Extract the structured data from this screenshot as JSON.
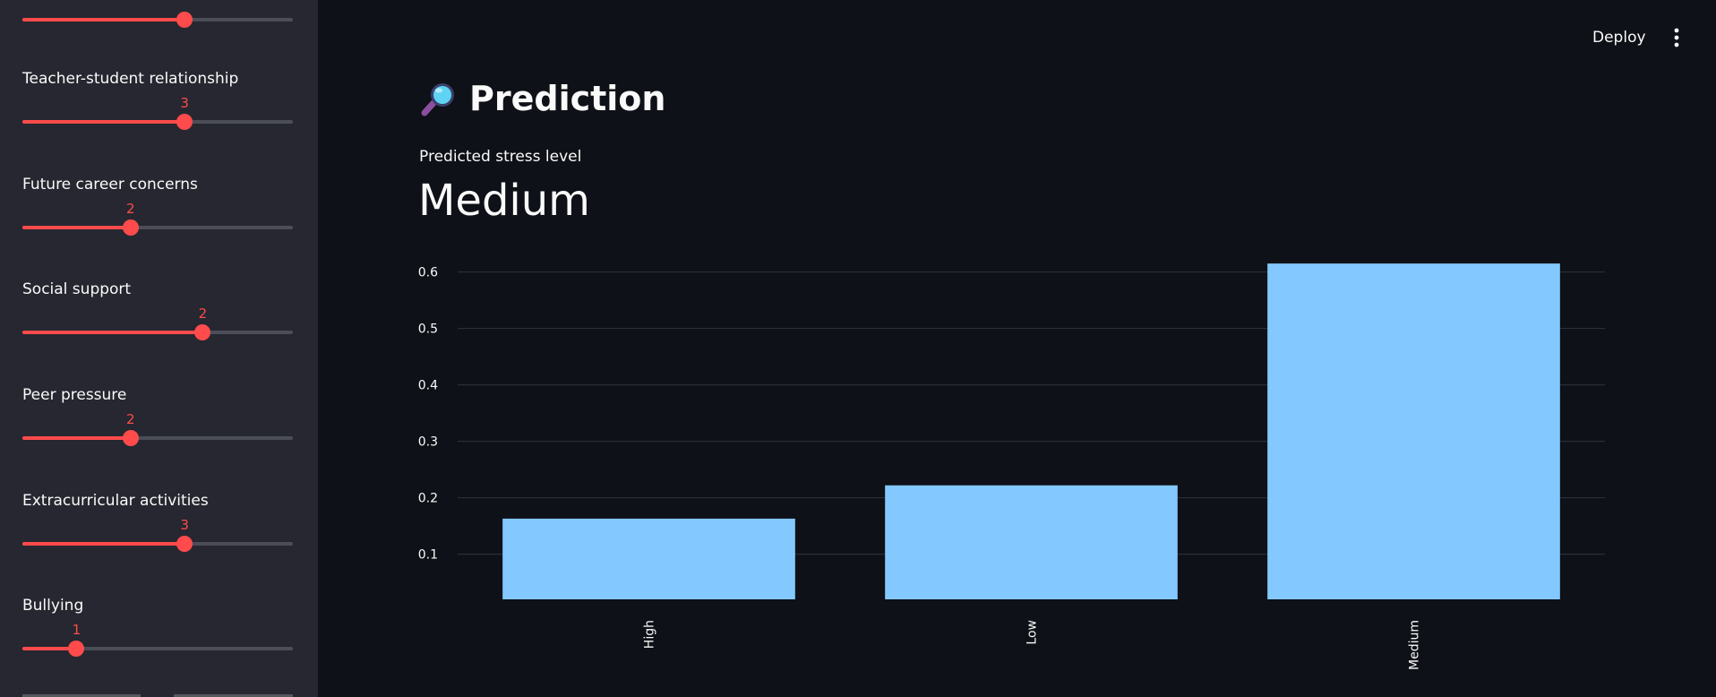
{
  "sidebar": {
    "sliders": [
      {
        "label": "",
        "value": 3,
        "value_text": "3",
        "fraction": 0.6,
        "show_value": false
      },
      {
        "label": "Teacher-student relationship",
        "value": 3,
        "value_text": "3",
        "fraction": 0.6,
        "show_value": true
      },
      {
        "label": "Future career concerns",
        "value": 2,
        "value_text": "2",
        "fraction": 0.4,
        "show_value": true
      },
      {
        "label": "Social support",
        "value": 2,
        "value_text": "2",
        "fraction": 0.667,
        "show_value": true
      },
      {
        "label": "Peer pressure",
        "value": 2,
        "value_text": "2",
        "fraction": 0.4,
        "show_value": true
      },
      {
        "label": "Extracurricular activities",
        "value": 3,
        "value_text": "3",
        "fraction": 0.6,
        "show_value": true
      },
      {
        "label": "Bullying",
        "value": 1,
        "value_text": "1",
        "fraction": 0.2,
        "show_value": true
      }
    ]
  },
  "header": {
    "deploy_label": "Deploy",
    "menu_icon": "vertical-ellipsis-icon"
  },
  "main": {
    "title_icon": "magnifying-glass-icon",
    "title": "Prediction",
    "metric_label": "Predicted stress level",
    "metric_value": "Medium"
  },
  "colors": {
    "accent": "#ff4b4b",
    "bar": "#83c9ff",
    "background": "#0e1117",
    "sidebar": "#262730"
  },
  "chart_data": {
    "type": "bar",
    "categories": [
      "High",
      "Low",
      "Medium"
    ],
    "values": [
      0.163,
      0.222,
      0.615
    ],
    "title": "",
    "xlabel": "",
    "ylabel": "",
    "ylim": [
      0.02,
      0.62
    ],
    "yticks": [
      0.1,
      0.2,
      0.3,
      0.4,
      0.5,
      0.6
    ],
    "ytick_labels": [
      "0.1",
      "0.2",
      "0.3",
      "0.4",
      "0.5",
      "0.6"
    ],
    "grid": true,
    "legend": "none"
  }
}
